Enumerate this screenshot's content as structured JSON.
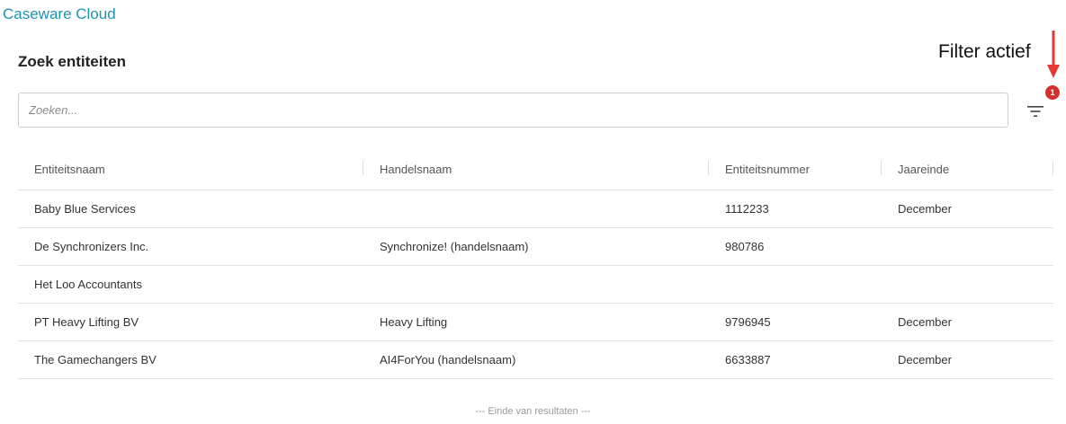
{
  "app": {
    "title": "Caseware Cloud"
  },
  "page": {
    "title": "Zoek entiteiten"
  },
  "search": {
    "placeholder": "Zoeken...",
    "value": ""
  },
  "filter": {
    "badge_count": "1",
    "icon": "filter-icon"
  },
  "annotation": {
    "text": "Filter actief",
    "arrow_color": "#e53935"
  },
  "table": {
    "headers": [
      "Entiteitsnaam",
      "Handelsnaam",
      "Entiteitsnummer",
      "Jaareinde"
    ],
    "rows": [
      [
        "Baby Blue Services",
        "",
        "1112233",
        "December"
      ],
      [
        "De Synchronizers Inc.",
        "Synchronize! (handelsnaam)",
        "980786",
        ""
      ],
      [
        "Het Loo Accountants",
        "",
        "",
        ""
      ],
      [
        "PT Heavy Lifting BV",
        "Heavy Lifting",
        "9796945",
        "December"
      ],
      [
        "The Gamechangers BV",
        "AI4ForYou (handelsnaam)",
        "6633887",
        "December"
      ]
    ]
  },
  "footer": {
    "end_text": "--- Einde van resultaten ---"
  },
  "colors": {
    "brand": "#1f93b4",
    "badge": "#d32f2f",
    "border": "#cfcfcf"
  }
}
